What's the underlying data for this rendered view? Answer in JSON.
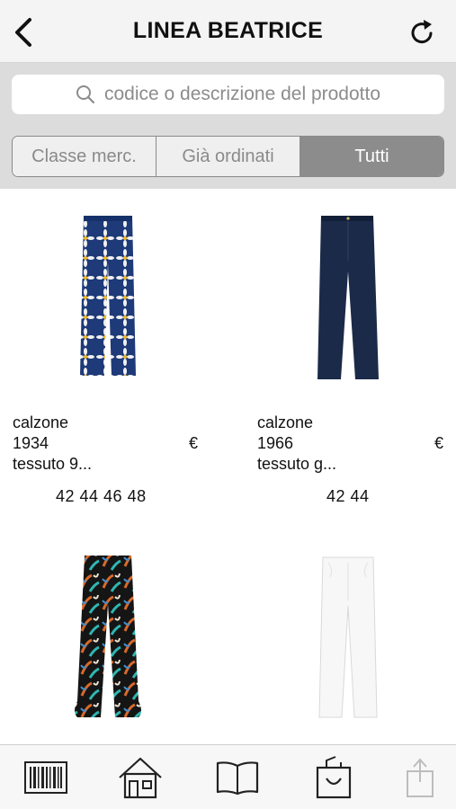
{
  "header": {
    "title": "LINEA BEATRICE"
  },
  "search": {
    "placeholder": "codice o descrizione del prodotto"
  },
  "segments": [
    {
      "label": "Classe merc."
    },
    {
      "label": "Già ordinati"
    },
    {
      "label": "Tutti",
      "active": true
    }
  ],
  "products": [
    {
      "name": "calzone",
      "code": "1934",
      "currency": "€",
      "description": "tessuto 9...",
      "sizes": "42 44 46 48",
      "pattern": "navy-floral"
    },
    {
      "name": "calzone",
      "code": "1966",
      "currency": "€",
      "description": "tessuto g...",
      "sizes": "42 44",
      "pattern": "navy-solid"
    },
    {
      "name": "",
      "code": "",
      "currency": "",
      "description": "",
      "sizes": "",
      "pattern": "black-feather-print"
    },
    {
      "name": "",
      "code": "",
      "currency": "",
      "description": "",
      "sizes": "",
      "pattern": "white-solid"
    }
  ],
  "tabbar": [
    {
      "icon": "barcode-icon"
    },
    {
      "icon": "home-icon"
    },
    {
      "icon": "catalog-book-icon"
    },
    {
      "icon": "shopping-bag-icon"
    },
    {
      "icon": "share-icon",
      "disabled": true
    }
  ],
  "colors": {
    "navbar": "#f4f4f4",
    "search_band": "#dcdcdc",
    "segment_active": "#8c8c8c",
    "navy": "#1b2a48"
  }
}
